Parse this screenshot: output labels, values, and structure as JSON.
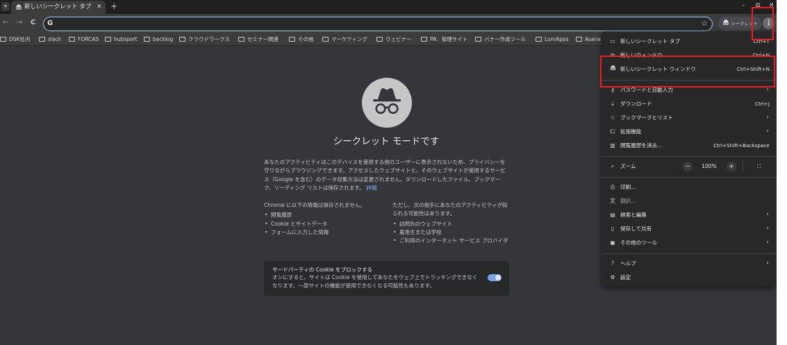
{
  "tab": {
    "search_icon": "▾",
    "icon": "incognito-icon",
    "title": "新しいシークレット タブ",
    "close": "✕",
    "new_tab": "+"
  },
  "window_controls": {
    "minimize": "–",
    "restore": "⧉",
    "close": "✕"
  },
  "toolbar": {
    "back": "←",
    "forward": "→",
    "reload": "C",
    "omnibox_icon": "G",
    "omnibox_value": "",
    "star": "☆",
    "incognito_label": "シークレット",
    "menu": "⋮"
  },
  "bookmarks": [
    "DSK社内",
    "slack",
    "FORCAS",
    "hubsport",
    "backlog",
    "クラウドワークス",
    "セミナー関連",
    "その他",
    "マーケティング",
    "ウェビナー",
    "PA：管理サイト",
    "バナー作成ツール",
    "LumApps",
    "Asana"
  ],
  "content": {
    "title": "シークレット モードです",
    "description": "あなたのアクティビティはこのデバイスを使用する他のユーザーに表示されないため、プライバシーを守りながらブラウジングできます。アクセスしたウェブサイトと、そのウェブサイトが使用するサービス（Google を含む）のデータ収集方法は変更されません。ダウンロードしたファイル、ブックマーク、リーディング リストは保存されます。",
    "details_link": "詳細",
    "left_heading": "Chrome に以下の情報は保存されません。",
    "left_items": [
      "閲覧履歴",
      "Cookie とサイトデータ",
      "フォームに入力した情報"
    ],
    "right_heading": "ただし、次の相手にあなたのアクティビティが知られる可能性はあります。",
    "right_items": [
      "訪問先のウェブサイト",
      "雇用主または学校",
      "ご利用のインターネット サービス プロバイダ"
    ],
    "cookie_title": "サードパーティの Cookie をブロックする",
    "cookie_body": "オンにすると、サイトは Cookie を使用してあなたをウェブ上でトラッキングできなくなります。一部サイトの機能が使用できなくなる可能性もあります。",
    "cookie_toggle_on": true
  },
  "menu": {
    "items": [
      {
        "icon": "new-tab-icon",
        "label": "新しいシークレット タブ",
        "shortcut": "Ctrl+T"
      },
      {
        "icon": "new-window-icon",
        "label": "新しいウィンドウ",
        "shortcut": "Ctrl+N"
      },
      {
        "icon": "incognito-icon",
        "label": "新しいシークレット ウィンドウ",
        "shortcut": "Ctrl+Shift+N"
      },
      {
        "icon": "key-icon",
        "label": "パスワードと自動入力",
        "shortcut": ""
      },
      {
        "icon": "download-icon",
        "label": "ダウンロード",
        "shortcut": "Ctrl+J"
      },
      {
        "icon": "star-icon",
        "label": "ブックマークとリスト",
        "shortcut": ""
      },
      {
        "icon": "extension-icon",
        "label": "拡張機能",
        "shortcut": ""
      },
      {
        "icon": "trash-icon",
        "label": "閲覧履歴を消去...",
        "shortcut": "Ctrl+Shift+Backspace"
      },
      {
        "icon": "print-icon",
        "label": "印刷...",
        "shortcut": ""
      },
      {
        "icon": "translate-icon",
        "label": "翻訳...",
        "shortcut": ""
      },
      {
        "icon": "search-icon",
        "label": "検索と編集",
        "shortcut": ""
      },
      {
        "icon": "save-icon",
        "label": "保存して共有",
        "shortcut": ""
      },
      {
        "icon": "toolbox-icon",
        "label": "その他のツール",
        "shortcut": ""
      },
      {
        "icon": "help-icon",
        "label": "ヘルプ",
        "shortcut": ""
      },
      {
        "icon": "settings-icon",
        "label": "設定",
        "shortcut": ""
      }
    ],
    "zoom": {
      "label": "ズーム",
      "minus": "−",
      "value": "100%",
      "plus": "+",
      "fullscreen": "⛶"
    },
    "submenu_arrow": "›"
  },
  "colors": {
    "window_bg": "#35363a",
    "toolbar_bg": "#3c3c3c",
    "menu_bg": "#282828",
    "omnibox_focus": "#a8c7fa",
    "highlight": "#ee1c24",
    "toggle_on": "#7ea2e4"
  }
}
